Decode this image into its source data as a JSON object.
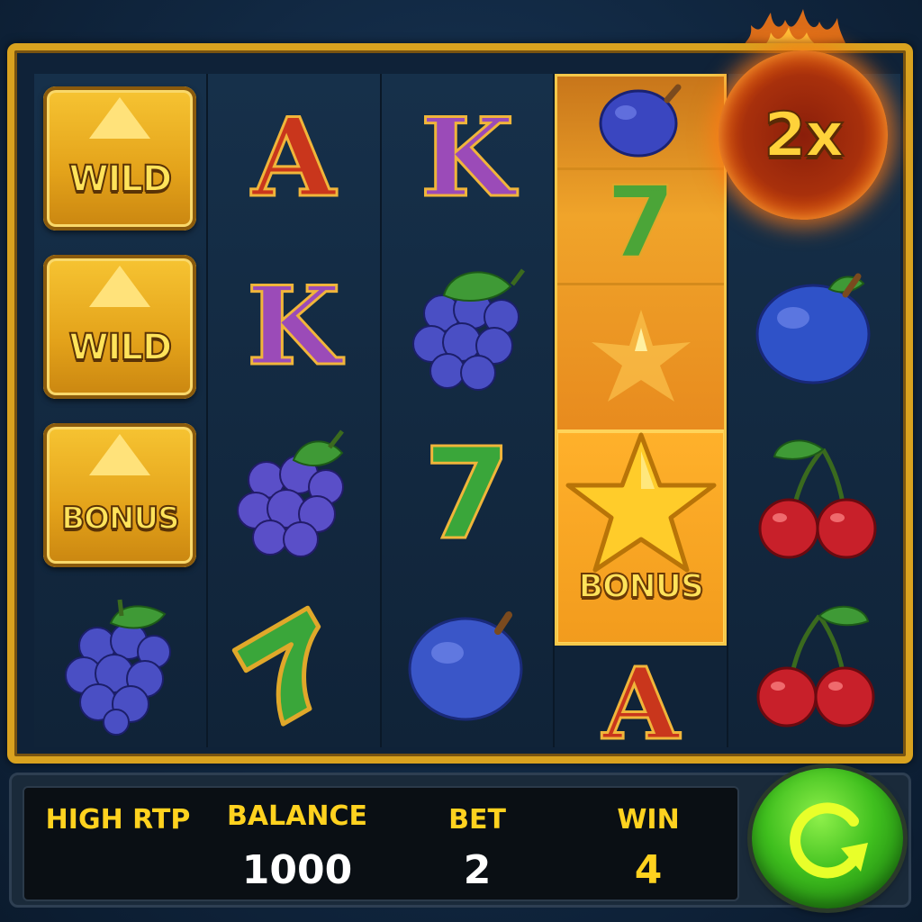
{
  "colors": {
    "gold": "#d9a21f",
    "label_yellow": "#ffd21f",
    "value_white": "#ffffff",
    "win_yellow": "#ffd21f",
    "spin_green": "#3fbf1e"
  },
  "multiplier": {
    "text": "2x"
  },
  "reels": [
    {
      "symbols": [
        {
          "kind": "tile",
          "text": "WILD"
        },
        {
          "kind": "tile",
          "text": "WILD"
        },
        {
          "kind": "tile",
          "text": "BONUS"
        },
        {
          "kind": "icon",
          "icon": "grapes-icon"
        }
      ]
    },
    {
      "symbols": [
        {
          "kind": "letter",
          "text": "A"
        },
        {
          "kind": "letter",
          "text": "K"
        },
        {
          "kind": "icon",
          "icon": "grapes-icon"
        },
        {
          "kind": "icon",
          "icon": "seven-icon"
        }
      ]
    },
    {
      "symbols": [
        {
          "kind": "letter",
          "text": "K"
        },
        {
          "kind": "icon",
          "icon": "grapes-icon"
        },
        {
          "kind": "icon",
          "icon": "seven-icon",
          "text": "7"
        },
        {
          "kind": "icon",
          "icon": "plum-icon"
        }
      ]
    },
    {
      "symbols": [
        {
          "kind": "icon",
          "icon": "plum-icon"
        },
        {
          "kind": "icon",
          "icon": "seven-icon",
          "text": "7"
        },
        {
          "kind": "icon",
          "icon": "flame-burst-icon"
        },
        {
          "kind": "bonus-star",
          "icon": "star-icon",
          "text": "BONUS"
        },
        {
          "kind": "letter",
          "text": "A"
        }
      ]
    },
    {
      "symbols": [
        {
          "kind": "multiplier"
        },
        {
          "kind": "icon",
          "icon": "plum-icon"
        },
        {
          "kind": "icon",
          "icon": "cherries-icon"
        },
        {
          "kind": "icon",
          "icon": "cherries-icon"
        }
      ]
    }
  ],
  "footer": {
    "high_rtp": "HIGH RTP",
    "balance_label": "BALANCE",
    "balance_value": "1000",
    "bet_label": "BET",
    "bet_value": "2",
    "win_label": "WIN",
    "win_value": "4",
    "spin_icon": "refresh-arrow-icon"
  }
}
